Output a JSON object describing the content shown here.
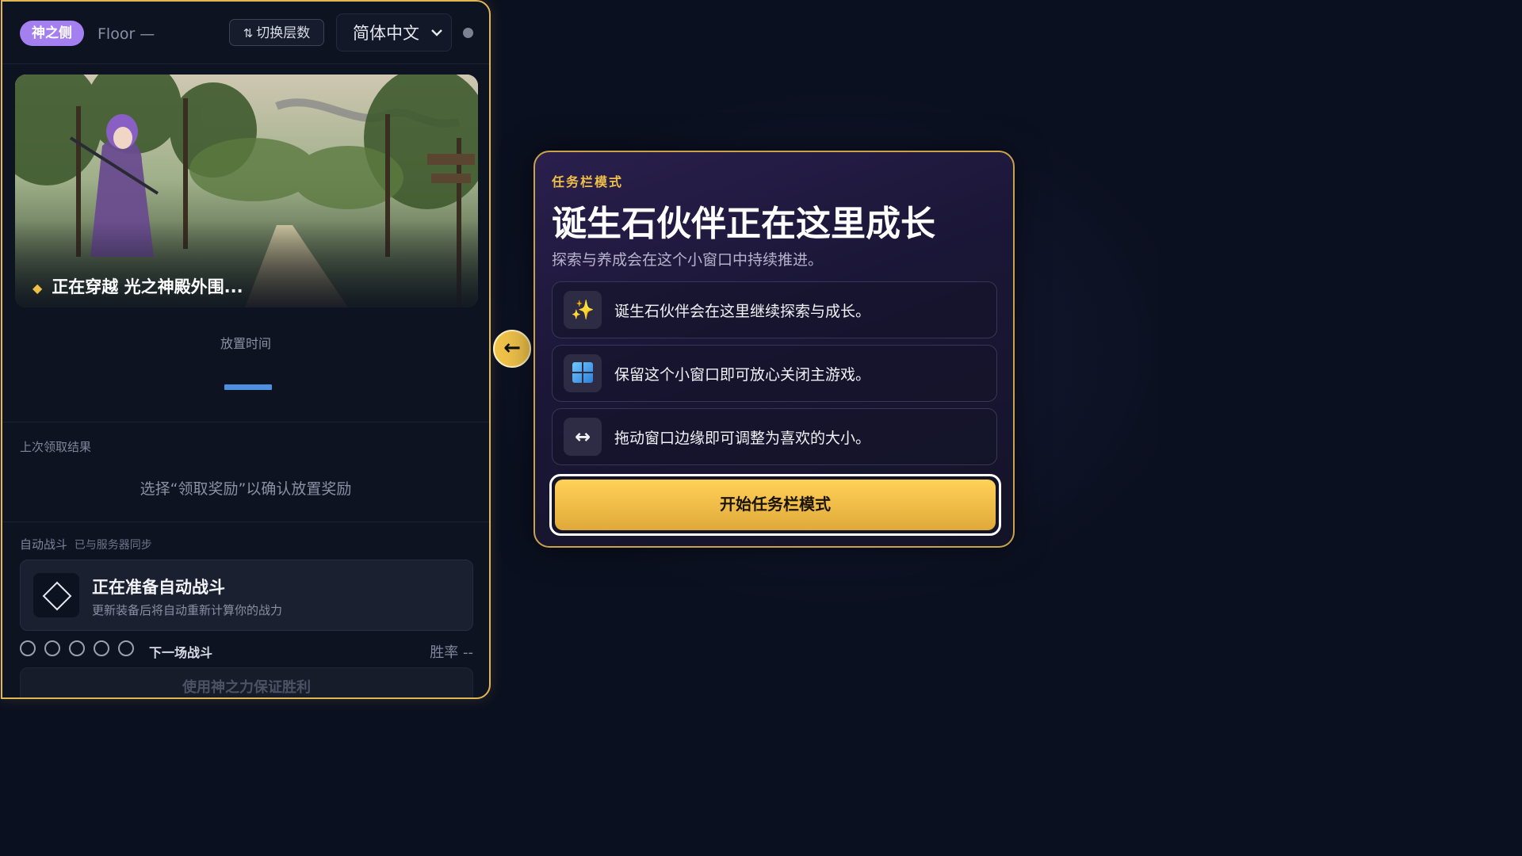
{
  "left_panel": {
    "side_badge": "神之侧",
    "floor_label": "Floor —",
    "switch_floor_button": "切换层数",
    "language": "简体中文",
    "scene_caption": "正在穿越 光之神殿外围...",
    "idle_time_label": "放置时间",
    "last_claim_title": "上次领取结果",
    "claim_hint": "选择“领取奖励”以确认放置奖励",
    "auto_battle_title": "自动战斗",
    "auto_battle_sync": "已与服务器同步",
    "battle_card_title": "正在准备自动战斗",
    "battle_card_desc": "更新装备后将自动重新计算你的战力",
    "next_battle_label": "下一场战斗",
    "win_rate": "胜率 --",
    "god_power_button": "使用神之力保证胜利",
    "battle_dots": [
      0,
      0,
      0,
      0,
      0
    ]
  },
  "toggle": {
    "icon": "arrow-left-icon",
    "glyph": "←"
  },
  "taskbar_card": {
    "tag": "任务栏模式",
    "title": "诞生石伙伴正在这里成长",
    "subtitle": "探索与养成会在这个小窗口中持续推进。",
    "features": [
      {
        "icon": "sparkles-icon",
        "text": "诞生石伙伴会在这里继续探索与成长。"
      },
      {
        "icon": "window-icon",
        "text": "保留这个小窗口即可放心关闭主游戏。"
      },
      {
        "icon": "resize-arrows-icon",
        "text": "拖动窗口边缘即可调整为喜欢的大小。"
      }
    ],
    "start_button": "开始任务栏模式"
  },
  "colors": {
    "accent_gold": "#f0bf47",
    "badge_purple": "#a47ff0",
    "progress_blue": "#4d8fe0",
    "background": "#0b1020"
  }
}
